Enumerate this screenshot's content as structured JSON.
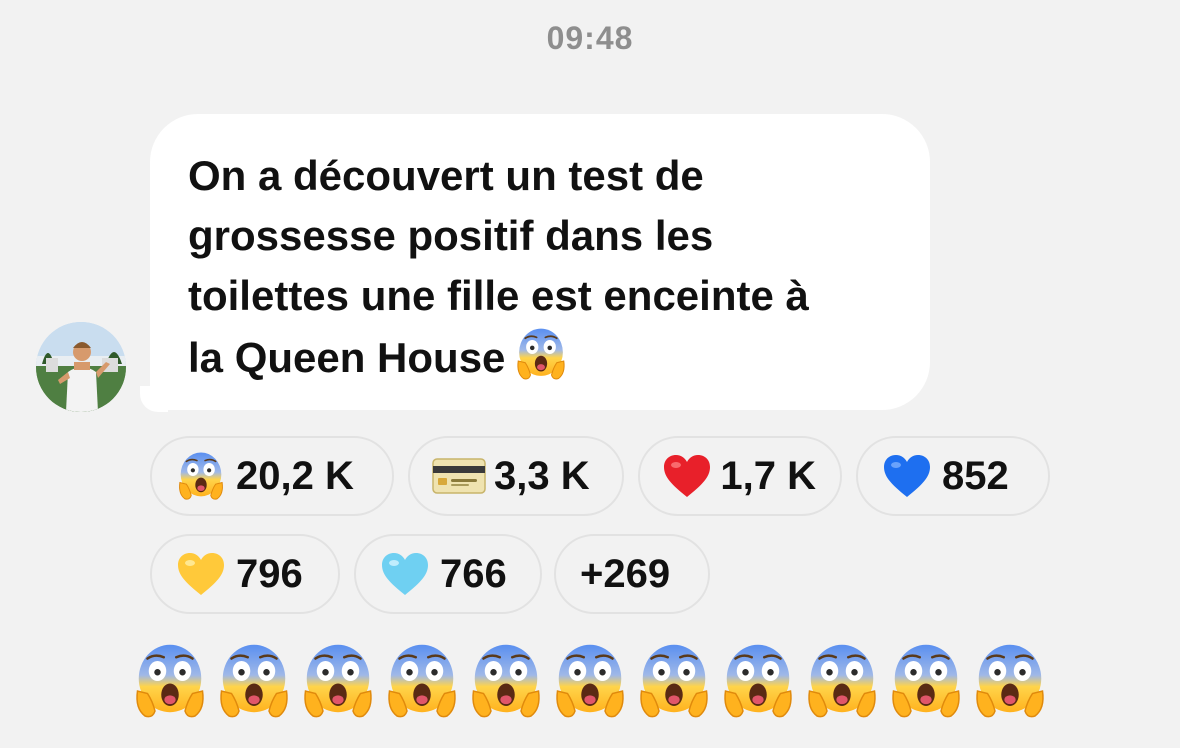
{
  "header": {
    "time": "09:48"
  },
  "message": {
    "text": "On a découvert un test de\ngrossesse positif dans les\ntoilettes une fille est enceinte à\nla Queen House",
    "trailing_emoji": "face-screaming-in-fear-icon"
  },
  "reactions": [
    {
      "icon": "face-screaming-in-fear-icon",
      "count": "20,2 K"
    },
    {
      "icon": "credit-card-icon",
      "count": "3,3 K"
    },
    {
      "icon": "red-heart-icon",
      "count": "1,7 K"
    },
    {
      "icon": "blue-heart-icon",
      "count": "852"
    },
    {
      "icon": "yellow-heart-icon",
      "count": "796"
    },
    {
      "icon": "light-blue-heart-icon",
      "count": "766"
    },
    {
      "icon": "",
      "count": "+269"
    }
  ],
  "emoji_row": {
    "icon": "face-screaming-in-fear-icon",
    "repeat": 11
  },
  "colors": {
    "background": "#f2f2f2",
    "bubble": "#ffffff",
    "time": "#8e8e8e",
    "red_heart": "#e8202a",
    "blue_heart": "#1e6ff0",
    "yellow_heart": "#ffc93a",
    "light_blue_heart": "#6fd0f2"
  }
}
